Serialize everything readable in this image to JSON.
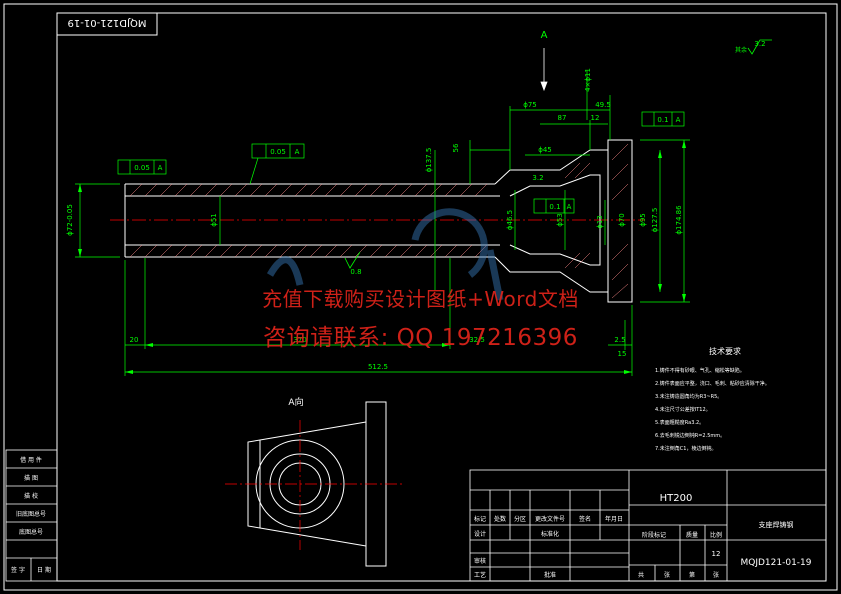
{
  "title_block": {
    "drawing_no": "MQJD121-01-19",
    "part_name": "支座焊铸钢",
    "material": "HT200",
    "sheet_count": "12"
  },
  "title_block_labels": [
    "标记",
    "处数",
    "分区",
    "更改文件号",
    "签名",
    "年月日",
    "设计",
    "标准化",
    "阶段标记",
    "质量",
    "比例",
    "审核",
    "工艺",
    "批准",
    "共",
    "张",
    "第",
    "张"
  ],
  "left_strip_labels": [
    "借 用 件",
    "描 图",
    "描 校",
    "旧底图总号",
    "底图总号",
    "签 字",
    "日 期"
  ],
  "tech_requirements": {
    "heading": "技术要求",
    "items": [
      "1.铸件不得有砂眼、气孔、缩松等缺陷。",
      "2.铸件表面应平整，浇口、毛刺、粘砂应清除干净。",
      "3.未注铸造圆角均为R3~R5。",
      "4.未注尺寸公差按IT12。",
      "5.表面粗糙度Ra3.2。",
      "6.去毛刺锐边倒钝R=2.5mm。",
      "7.未注倒角C1，棱边倒钝。"
    ]
  },
  "dimensions": {
    "overall_length": "512.5",
    "length_370": "370",
    "length_20": "20",
    "length_32_5": "32.5",
    "length_2_5": "2.5",
    "length_15": "15",
    "length_56": "56",
    "length_12": "12",
    "length_87": "87",
    "length_49_5": "49.5",
    "dia_75": "ϕ75",
    "dia_72": "ϕ72-0.05",
    "dia_51": "ϕ51",
    "dia_45": "ϕ45",
    "dia_137": "ϕ137.5",
    "dia_46": "ϕ46.5",
    "dia_53": "ϕ53",
    "dia_95": "ϕ95",
    "dia_127": "ϕ127.5",
    "dia_174": "ϕ174.86",
    "dia_70": "ϕ70",
    "dia_13": "ϕ13",
    "holes": "4×ϕ11",
    "surface_finish": "3.2",
    "surface_finish_2": "0.8",
    "radius_32": "3.2"
  },
  "tolerances": {
    "t1_value": "0.05",
    "t1_datum": "A",
    "t2_value": "0.05",
    "t2_datum": "A",
    "t3_value": "0.1",
    "t3_datum": "A",
    "t4_value": "0.1",
    "t4_datum": "A"
  },
  "view_labels": {
    "arrow_label": "A",
    "section_label": "A向",
    "roughness_other": "其余"
  },
  "watermark": {
    "line1": "充值下载购买设计图纸+Word文档",
    "line2": "咨询请联系: QQ 197216396"
  },
  "colors": {
    "background": "#000000",
    "frame": "#ffffff",
    "dimension": "#00ff00",
    "centerline": "#ff0000",
    "hatch": "#ff8080",
    "watermark": "#e0241b",
    "logo": "#3a7fc0"
  }
}
